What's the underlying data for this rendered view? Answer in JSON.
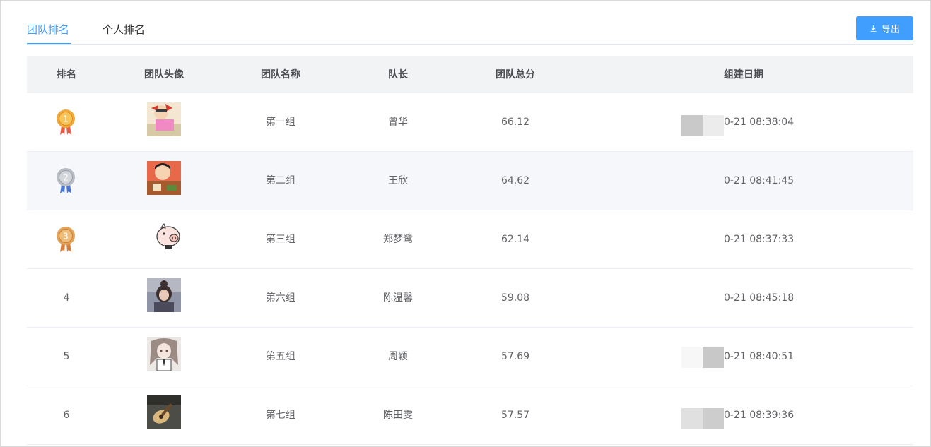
{
  "tabs": [
    {
      "label": "团队排名",
      "active": true
    },
    {
      "label": "个人排名",
      "active": false
    }
  ],
  "toolbar": {
    "export_label": "导出",
    "export_icon": "download-icon"
  },
  "colors": {
    "primary": "#409eff",
    "gold": "#f2a93b",
    "silver": "#b8bcc4",
    "bronze": "#e3a35a"
  },
  "table": {
    "headers": [
      "排名",
      "团队头像",
      "团队名称",
      "队长",
      "团队总分",
      "组建日期"
    ],
    "rows": [
      {
        "rank": "1",
        "medal": "gold-medal-icon",
        "avatar": "cartoon-girl-avatar",
        "name": "第一组",
        "leader": "曾华",
        "score": "66.12",
        "date": "0-21 08:38:04"
      },
      {
        "rank": "2",
        "medal": "silver-medal-icon",
        "avatar": "cartoon-boy-avatar",
        "name": "第二组",
        "leader": "王欣",
        "score": "64.62",
        "date": "0-21 08:41:45"
      },
      {
        "rank": "3",
        "medal": "bronze-medal-icon",
        "avatar": "pig-avatar",
        "name": "第三组",
        "leader": "郑梦鹭",
        "score": "62.14",
        "date": "0-21 08:37:33"
      },
      {
        "rank": "4",
        "avatar": "girl-photo-avatar",
        "name": "第六组",
        "leader": "陈温馨",
        "score": "59.08",
        "date": "0-21 08:45:18"
      },
      {
        "rank": "5",
        "avatar": "anime-girl-avatar",
        "name": "第五组",
        "leader": "周颖",
        "score": "57.69",
        "date": "0-21 08:40:51"
      },
      {
        "rank": "6",
        "avatar": "guitar-photo-avatar",
        "name": "第七组",
        "leader": "陈田雯",
        "score": "57.57",
        "date": "0-21 08:39:36"
      }
    ]
  }
}
